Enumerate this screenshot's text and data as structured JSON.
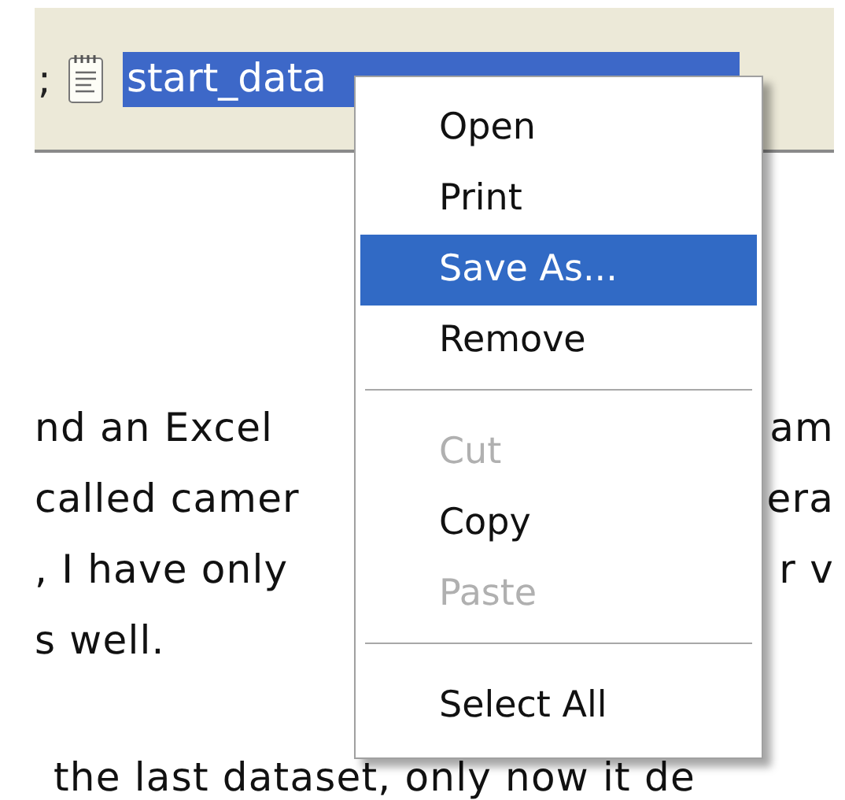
{
  "toolbar": {
    "separator": ";",
    "attachment": {
      "text": "start_data",
      "selected": true
    }
  },
  "paragraphs": [
    {
      "lines": [
        {
          "left": "nd an Excel",
          "right": "am"
        },
        {
          "left": "called camer",
          "right": "era"
        },
        {
          "left": ", I have only",
          "right": "r v"
        },
        {
          "left": "s well."
        }
      ]
    },
    {
      "lines": [
        {
          "left": "the last dataset, only now it de"
        }
      ]
    }
  ],
  "context_menu": {
    "items": [
      {
        "kind": "command",
        "label": "Open",
        "disabled": false,
        "selected": false
      },
      {
        "kind": "command",
        "label": "Print",
        "disabled": false,
        "selected": false
      },
      {
        "kind": "command",
        "label": "Save As...",
        "disabled": false,
        "selected": true
      },
      {
        "kind": "command",
        "label": "Remove",
        "disabled": false,
        "selected": false
      },
      {
        "kind": "separator"
      },
      {
        "kind": "command",
        "label": "Cut",
        "disabled": true,
        "selected": false
      },
      {
        "kind": "command",
        "label": "Copy",
        "disabled": false,
        "selected": false
      },
      {
        "kind": "command",
        "label": "Paste",
        "disabled": true,
        "selected": false
      },
      {
        "kind": "separator"
      },
      {
        "kind": "command",
        "label": "Select All",
        "disabled": false,
        "selected": false
      }
    ]
  }
}
